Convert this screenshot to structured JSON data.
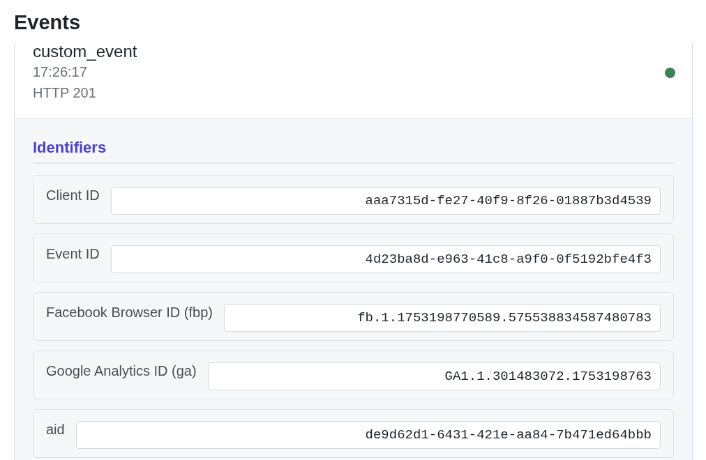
{
  "heading": "Events",
  "events": [
    {
      "name": "custom_event",
      "time": "17:26:17",
      "status": "HTTP 201",
      "color": "#3b8254",
      "expanded": true,
      "section": {
        "title": "Identifiers",
        "fields": [
          {
            "label": "Client ID",
            "value": "aaa7315d-fe27-40f9-8f26-01887b3d4539"
          },
          {
            "label": "Event ID",
            "value": "4d23ba8d-e963-41c8-a9f0-0f5192bfe4f3"
          },
          {
            "label": "Facebook Browser ID (fbp)",
            "value": "fb.1.1753198770589.575538834587480783"
          },
          {
            "label": "Google Analytics ID (ga)",
            "value": "GA1.1.301483072.1753198763"
          },
          {
            "label": "aid",
            "value": "de9d62d1-6431-421e-aa84-7b471ed64bbb"
          }
        ]
      }
    }
  ]
}
